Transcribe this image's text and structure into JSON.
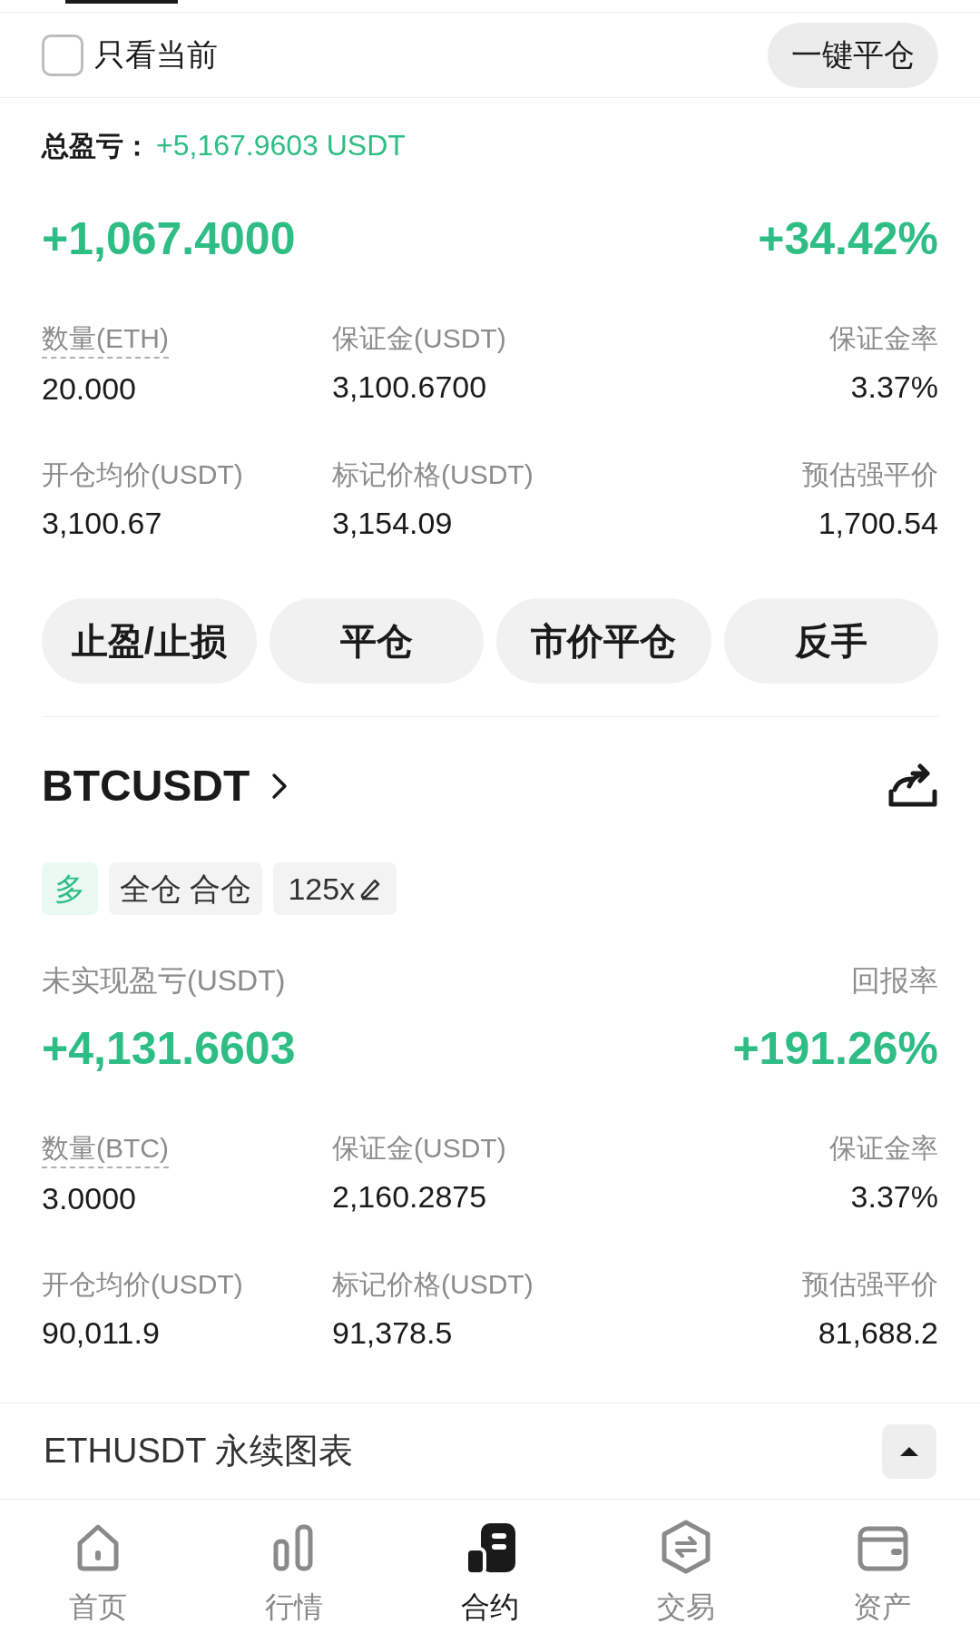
{
  "filter": {
    "label": "只看当前",
    "checked": false
  },
  "close_all_button": "一键平仓",
  "total_pnl": {
    "label": "总盈亏：",
    "value": "+5,167.9603 USDT"
  },
  "positions": [
    {
      "pnl": "+1,067.4000",
      "roe": "+34.42%",
      "stats": [
        {
          "label": "数量(ETH)",
          "value": "20.000",
          "hint": true
        },
        {
          "label": "保证金(USDT)",
          "value": "3,100.6700",
          "hint": false
        },
        {
          "label": "保证金率",
          "value": "3.37%",
          "hint": false
        },
        {
          "label": "开仓均价(USDT)",
          "value": "3,100.67",
          "hint": false
        },
        {
          "label": "标记价格(USDT)",
          "value": "3,154.09",
          "hint": false
        },
        {
          "label": "预估强平价",
          "value": "1,700.54",
          "hint": false
        }
      ],
      "actions": [
        "止盈/止损",
        "平仓",
        "市价平仓",
        "反手"
      ]
    },
    {
      "symbol": "BTCUSDT",
      "side": "多",
      "margin_mode": "全仓 合仓",
      "leverage": "125x",
      "pnl_label": "未实现盈亏(USDT)",
      "roe_label": "回报率",
      "pnl": "+4,131.6603",
      "roe": "+191.26%",
      "stats": [
        {
          "label": "数量(BTC)",
          "value": "3.0000",
          "hint": true
        },
        {
          "label": "保证金(USDT)",
          "value": "2,160.2875",
          "hint": false
        },
        {
          "label": "保证金率",
          "value": "3.37%",
          "hint": false
        },
        {
          "label": "开仓均价(USDT)",
          "value": "90,011.9",
          "hint": false
        },
        {
          "label": "标记价格(USDT)",
          "value": "91,378.5",
          "hint": false
        },
        {
          "label": "预估强平价",
          "value": "81,688.2",
          "hint": false
        }
      ]
    }
  ],
  "chart_bar": {
    "title": "ETHUSDT 永续图表",
    "expanded": false
  },
  "nav": [
    {
      "label": "首页",
      "kind": "home",
      "selected": false
    },
    {
      "label": "行情",
      "kind": "market",
      "selected": false
    },
    {
      "label": "合约",
      "kind": "futures",
      "selected": true
    },
    {
      "label": "交易",
      "kind": "trade",
      "selected": false
    },
    {
      "label": "资产",
      "kind": "wallet",
      "selected": false
    }
  ]
}
